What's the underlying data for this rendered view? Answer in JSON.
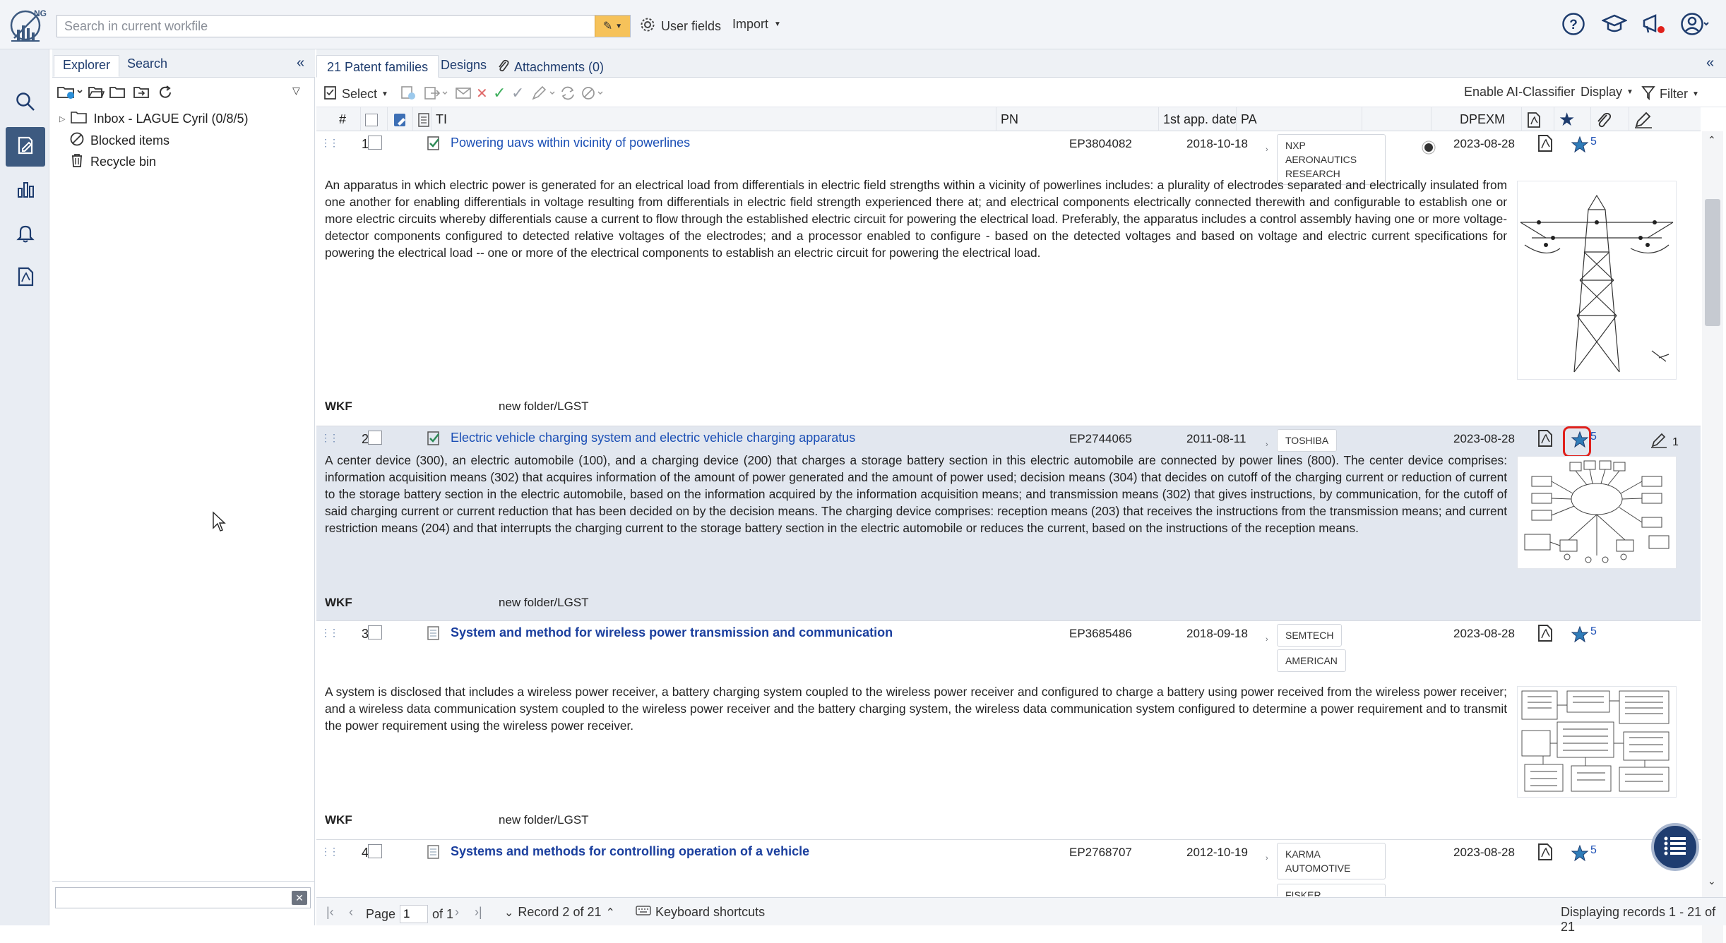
{
  "topbar": {
    "logo_text": "NG",
    "search_placeholder": "Search in current workfile",
    "user_fields_label": "User fields",
    "import_label": "Import"
  },
  "explorer": {
    "tab_explorer": "Explorer",
    "tab_search": "Search",
    "tree": [
      {
        "label": "Inbox - LAGUE Cyril (0/8/5)",
        "icon": "folder-icon"
      },
      {
        "label": "Blocked items",
        "icon": "blocked-icon"
      },
      {
        "label": "Recycle bin",
        "icon": "trash-icon"
      }
    ],
    "filter_value": ""
  },
  "main": {
    "tabs": [
      {
        "label": "21 Patent families"
      },
      {
        "label": "Designs"
      },
      {
        "label": "Attachments (0)"
      }
    ],
    "toolbar": {
      "select_label": "Select",
      "ai_label": "Enable AI-Classifier",
      "display_label": "Display",
      "filter_label": "Filter"
    },
    "columns": {
      "num": "#",
      "ti": "TI",
      "pn": "PN",
      "date": "1st app. date",
      "pa": "PA",
      "dpexm": "DPEXM"
    },
    "records": [
      {
        "num": "1",
        "title": "Powering uavs within vicinity of powerlines",
        "pn": "EP3804082",
        "date": "2018-10-18",
        "pa": [
          "NXP AERONAUTICS RESEARCH"
        ],
        "dpexm": "2023-08-28",
        "stars": "5",
        "abstract": "An apparatus in which electric power is generated for an electrical load from differentials in electric field strengths within a vicinity of powerlines includes: a plurality of electrodes separated and electrically insulated from one another for enabling differentials in voltage resulting from differentials in electric field strength experienced there at; and electrical components electrically connected therewith and configurable to establish one or more electric circuits whereby differentials cause a current to flow through the established electric circuit for powering the electrical load. Preferably, the apparatus includes a control assembly having one or more voltage-detector components configured to detected relative voltages of the electrodes; and a processor enabled to configure - based on the detected voltages and based on voltage and electric current specifications for powering the electrical load -- one or more of the electrical components to establish an electric circuit for powering the electrical load.",
        "wkf_label": "WKF",
        "wkf_value": "new folder/LGST"
      },
      {
        "num": "2",
        "title": "Electric vehicle charging system and electric vehicle charging apparatus",
        "pn": "EP2744065",
        "date": "2011-08-11",
        "pa": [
          "TOSHIBA"
        ],
        "dpexm": "2023-08-28",
        "stars": "5",
        "edits": "1",
        "abstract": "A center device (300), an electric automobile (100), and a charging device (200) that charges a storage battery section in this electric automobile are connected by power lines (800). The center device comprises: information acquisition means (302) that acquires information of the amount of power generated and the amount of power used; decision means (304) that decides on cutoff of the charging current or reduction of current to the storage battery section in the electric automobile, based on the information acquired by the information acquisition means; and transmission means (302) that gives instructions, by communication, for the cutoff of said charging current or current reduction that has been decided on by the decision means. The charging device comprises: reception means (203) that receives the instructions from the transmission means; and current restriction means (204) and that interrupts the charging current to the storage battery section in the electric automobile or reduces the current, based on the instructions of the reception means.",
        "wkf_label": "WKF",
        "wkf_value": "new folder/LGST"
      },
      {
        "num": "3",
        "title": "System and method for wireless power transmission and communication",
        "pn": "EP3685486",
        "date": "2018-09-18",
        "pa": [
          "SEMTECH",
          "AMERICAN"
        ],
        "dpexm": "2023-08-28",
        "stars": "5",
        "abstract": "A system is disclosed that includes a wireless power receiver, a battery charging system coupled to the wireless power receiver and configured to charge a battery using power received from the wireless power receiver; and a wireless data communication system coupled to the wireless power receiver and the battery charging system, the wireless data communication system configured to determine a power requirement and to transmit the power requirement using the wireless power receiver.",
        "wkf_label": "WKF",
        "wkf_value": "new folder/LGST"
      },
      {
        "num": "4",
        "title": "Systems and methods for controlling operation of a vehicle",
        "pn": "EP2768707",
        "date": "2012-10-19",
        "pa": [
          "KARMA AUTOMOTIVE",
          "FISKER"
        ],
        "dpexm": "2023-08-28",
        "stars": "5"
      }
    ],
    "pager": {
      "page_label": "Page",
      "page_value": "1",
      "of_label": "of 1",
      "record_label": "Record 2 of 21",
      "shortcuts_label": "Keyboard shortcuts",
      "displaying_label": "Displaying records 1 - 21 of 21"
    }
  }
}
